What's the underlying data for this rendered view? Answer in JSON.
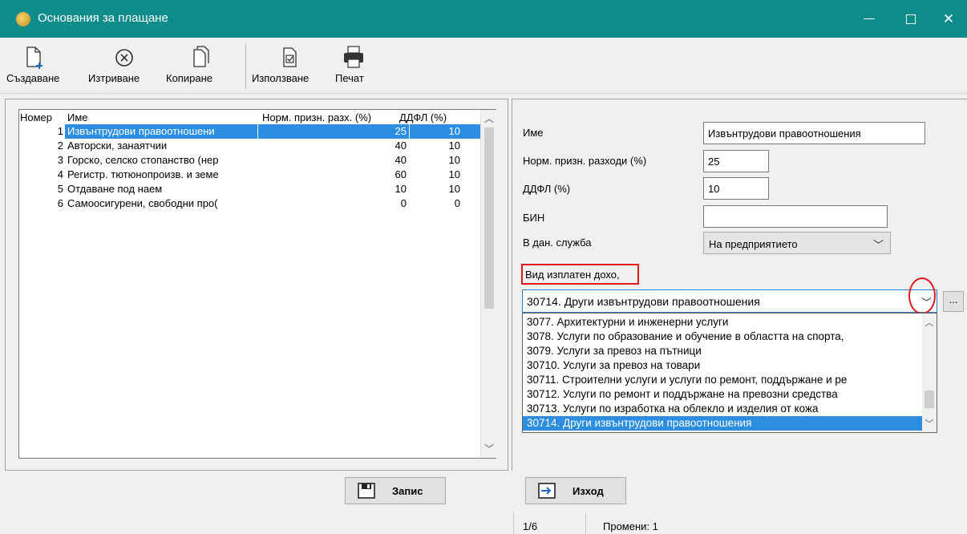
{
  "window": {
    "title": "Основания за плащане"
  },
  "toolbar": {
    "create": "Създаване",
    "delete": "Изтриване",
    "copy": "Копиране",
    "use": "Използване",
    "print": "Печат"
  },
  "grid": {
    "headers": {
      "num": "Номер",
      "name": "Име",
      "norm": "Норм. призн. разх. (%)",
      "ddfl": "ДДФЛ (%)"
    },
    "rows": [
      {
        "num": "1",
        "name": "Извънтрудови правоотношени",
        "norm": "25",
        "ddfl": "10"
      },
      {
        "num": "2",
        "name": "Авторски, занаятчии",
        "norm": "40",
        "ddfl": "10"
      },
      {
        "num": "3",
        "name": "Горско, селско стопанство (нер",
        "norm": "40",
        "ddfl": "10"
      },
      {
        "num": "4",
        "name": "Регистр. тютюнопроизв. и земе",
        "norm": "60",
        "ddfl": "10"
      },
      {
        "num": "5",
        "name": "Отдаване под наем",
        "norm": "10",
        "ddfl": "10"
      },
      {
        "num": "6",
        "name": "Самоосигурени, свободни про(",
        "norm": "0",
        "ddfl": "0"
      }
    ]
  },
  "form": {
    "name_label": "Име",
    "name_value": "Извънтрудови правоотношения",
    "norm_label": "Норм. призн. разходи (%)",
    "norm_value": "25",
    "ddfl_label": "ДДФЛ (%)",
    "ddfl_value": "10",
    "bin_label": "БИН",
    "bin_value": "",
    "tax_label": "В дан. служба",
    "tax_value": "На предприятието",
    "income_label": "Вид изплатен дохо,",
    "income_value": "30714. Други извънтрудови правоотношения",
    "more_button": "..."
  },
  "dropdown": {
    "items": [
      "3077. Архитектурни и инженерни услуги",
      "3078. Услуги по образование и обучение в областта на спорта,",
      "3079. Услуги за превоз на пътници",
      "30710. Услуги за превоз на товари",
      "30711. Строителни услуги и услуги по ремонт, поддържане и ре",
      "30712. Услуги по ремонт и поддържане на превозни средства",
      "30713. Услуги по изработка на облекло и изделия от кожа",
      "30714. Други извънтрудови правоотношения"
    ],
    "selected_index": 7
  },
  "buttons": {
    "save": "Запис",
    "exit": "Изход"
  },
  "status": {
    "position": "1/6",
    "changes": "Промени: 1"
  },
  "colors": {
    "titlebar": "#0e8c8c",
    "selection": "#2b8ee0",
    "highlight": "#e0191f"
  }
}
